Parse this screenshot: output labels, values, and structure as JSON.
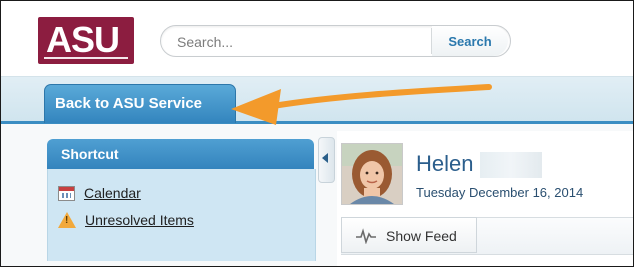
{
  "header": {
    "logo_text": "ASU",
    "search": {
      "placeholder": "Search...",
      "button_label": "Search"
    }
  },
  "tabs": {
    "back_label": "Back to ASU Service"
  },
  "shortcut": {
    "title": "Shortcut",
    "items": [
      {
        "label": "Calendar",
        "icon": "calendar-icon"
      },
      {
        "label": "Unresolved Items",
        "icon": "warning-icon"
      }
    ]
  },
  "profile": {
    "name": "Helen",
    "date": "Tuesday December 16, 2014",
    "feed_button_label": "Show Feed"
  },
  "colors": {
    "asu_maroon": "#8c1d40",
    "tab_blue": "#3385be",
    "arrow_orange": "#f39a2b",
    "panel_light_blue": "#cfe6f3"
  }
}
